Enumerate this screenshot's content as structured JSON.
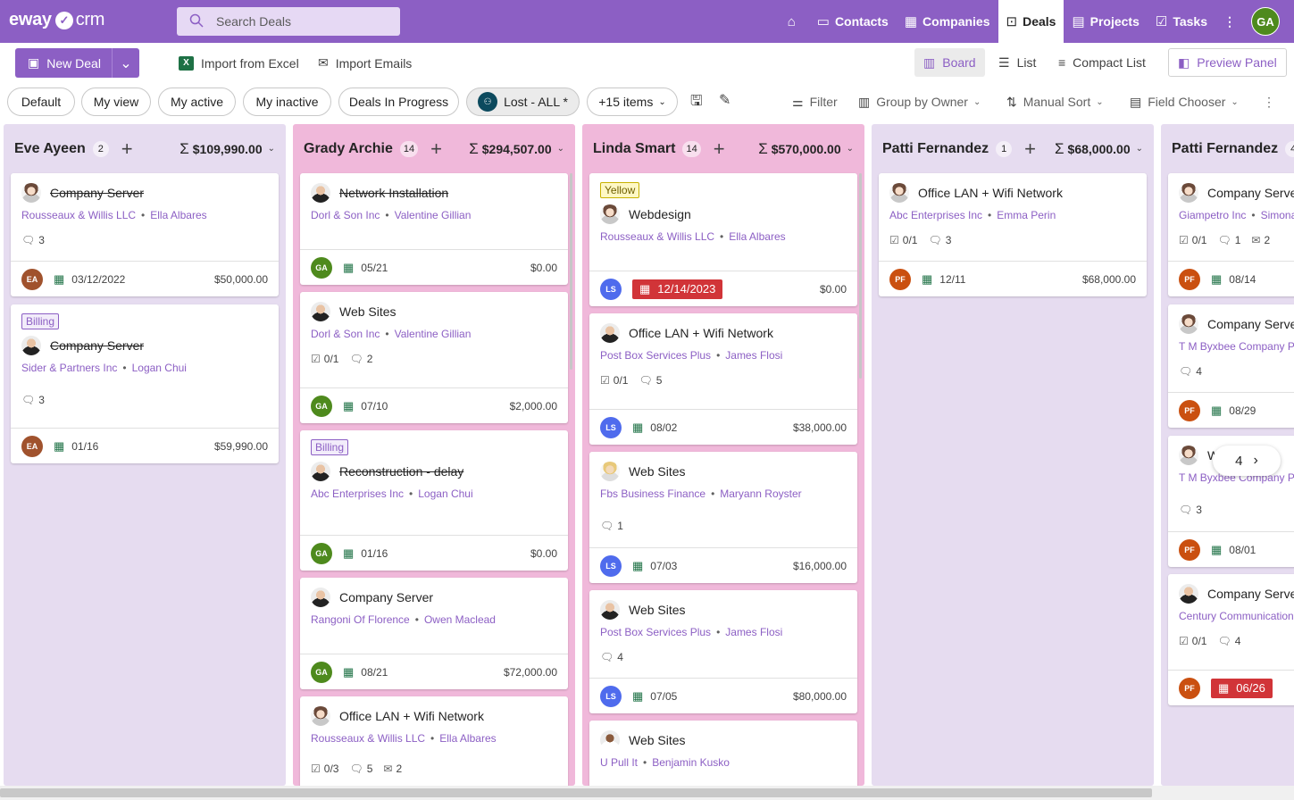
{
  "app": {
    "logo_left": "eway",
    "logo_right": "crm"
  },
  "search": {
    "placeholder": "Search Deals"
  },
  "nav": {
    "items": [
      {
        "label": "Contacts"
      },
      {
        "label": "Companies"
      },
      {
        "label": "Deals"
      },
      {
        "label": "Projects"
      },
      {
        "label": "Tasks"
      }
    ],
    "user_initials": "GA"
  },
  "toolbar": {
    "new_deal": "New Deal",
    "import_excel": "Import from Excel",
    "import_emails": "Import Emails",
    "board": "Board",
    "list": "List",
    "compact_list": "Compact List",
    "preview_panel": "Preview Panel"
  },
  "filters": {
    "views": [
      "Default",
      "My view",
      "My active",
      "My inactive",
      "Deals In Progress"
    ],
    "lost_all": "Lost - ALL *",
    "more_items": "+15 items",
    "filter": "Filter",
    "group_by": "Group by Owner",
    "sort": "Manual Sort",
    "field_chooser": "Field Chooser"
  },
  "colors": {
    "brand": "#8c5fc4",
    "overdue": "#d13438",
    "col_lavender": "#e6dcf0",
    "col_pink": "#f0b8da"
  },
  "columns": [
    {
      "name": "Eve Ayeen",
      "count": "2",
      "sum": "$109,990.00",
      "cards": [
        {
          "title": "Company Server",
          "company": "Rousseaux & Willis LLC",
          "contact": "Ella Albares",
          "comments": "3",
          "owner": "EA",
          "date": "03/12/2022",
          "amount": "$50,000.00"
        },
        {
          "tag": "Billing",
          "title": "Company Server",
          "company": "Sider & Partners Inc",
          "contact": "Logan Chui",
          "comments": "3",
          "owner": "EA",
          "date": "01/16",
          "amount": "$59,990.00"
        }
      ]
    },
    {
      "name": "Grady Archie",
      "count": "14",
      "sum": "$294,507.00",
      "cards": [
        {
          "title": "Network Installation",
          "company": "Dorl & Son Inc",
          "contact": "Valentine Gillian",
          "owner": "GA",
          "date": "05/21",
          "amount": "$0.00"
        },
        {
          "title": "Web Sites",
          "company": "Dorl & Son Inc",
          "contact": "Valentine Gillian",
          "tasks": "0/1",
          "comments": "2",
          "owner": "GA",
          "date": "07/10",
          "amount": "$2,000.00"
        },
        {
          "tag": "Billing",
          "title": "Reconstruction - delay",
          "company": "Abc Enterprises Inc",
          "contact": "Logan Chui",
          "owner": "GA",
          "date": "01/16",
          "amount": "$0.00"
        },
        {
          "title": "Company Server",
          "company": "Rangoni Of Florence",
          "contact": "Owen Maclead",
          "owner": "GA",
          "date": "08/21",
          "amount": "$72,000.00"
        },
        {
          "title": "Office LAN + Wifi Network",
          "company": "Rousseaux & Willis LLC",
          "contact": "Ella Albares",
          "tasks": "0/3",
          "comments": "5",
          "emails": "2"
        }
      ]
    },
    {
      "name": "Linda Smart",
      "count": "14",
      "sum": "$570,000.00",
      "cards": [
        {
          "tag": "Yellow",
          "title": "Webdesign",
          "company": "Rousseaux & Willis LLC",
          "contact": "Ella Albares",
          "owner": "LS",
          "date": "12/14/2023",
          "amount": "$0.00"
        },
        {
          "title": "Office LAN + Wifi Network",
          "company": "Post Box Services Plus",
          "contact": "James Flosi",
          "tasks": "0/1",
          "comments": "5",
          "owner": "LS",
          "date": "08/02",
          "amount": "$38,000.00"
        },
        {
          "title": "Web Sites",
          "company": "Fbs Business Finance",
          "contact": "Maryann Royster",
          "comments": "1",
          "owner": "LS",
          "date": "07/03",
          "amount": "$16,000.00"
        },
        {
          "title": "Web Sites",
          "company": "Post Box Services Plus",
          "contact": "James Flosi",
          "comments": "4",
          "owner": "LS",
          "date": "07/05",
          "amount": "$80,000.00"
        },
        {
          "title": "Web Sites",
          "company": "U Pull It",
          "contact": "Benjamin Kusko"
        }
      ]
    },
    {
      "name": "Patti Fernandez",
      "count": "1",
      "sum": "$68,000.00",
      "cards": [
        {
          "title": "Office LAN + Wifi Network",
          "company": "Abc Enterprises Inc",
          "contact": "Emma Perin",
          "tasks": "0/1",
          "comments": "3",
          "owner": "PF",
          "date": "12/11",
          "amount": "$68,000.00"
        }
      ]
    },
    {
      "name": "Patti Fernandez",
      "count": "4",
      "cards": [
        {
          "title": "Company Serve",
          "company": "Giampetro Inc",
          "contact": "Simona",
          "tasks": "0/1",
          "comments": "1",
          "emails": "2",
          "owner": "PF",
          "date": "08/14"
        },
        {
          "title": "Company Serve",
          "company": "T M Byxbee Company Po",
          "comments": "4",
          "owner": "PF",
          "date": "08/29"
        },
        {
          "title": "W",
          "company": "T M Byxbee Company Po",
          "comments": "3",
          "owner": "PF",
          "date": "08/01"
        },
        {
          "title": "Company Serve",
          "company": "Century Communication",
          "tasks": "0/1",
          "comments": "4",
          "owner": "PF",
          "date": "06/26"
        }
      ]
    }
  ],
  "pager": {
    "value": "4"
  }
}
